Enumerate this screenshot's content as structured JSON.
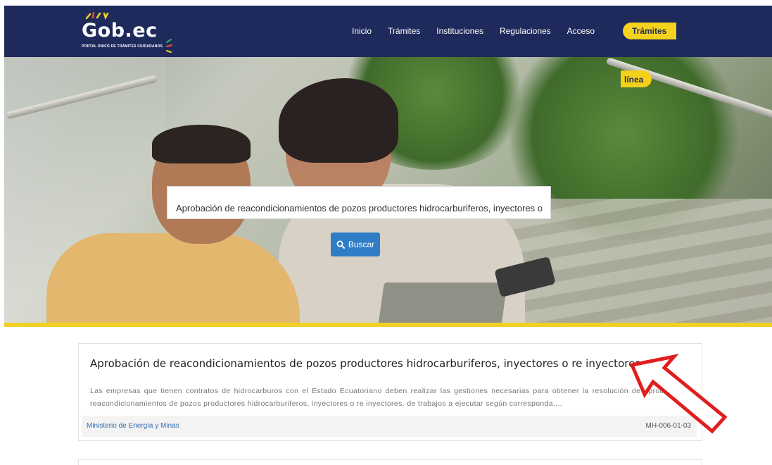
{
  "header": {
    "logo_text": "Gob.ec",
    "logo_subtitle": "PORTAL ÚNICO DE TRÁMITES CIUDADANOS",
    "nav": [
      {
        "label": "Inicio"
      },
      {
        "label": "Trámites"
      },
      {
        "label": "Instituciones"
      },
      {
        "label": "Regulaciones"
      },
      {
        "label": "Acceso"
      }
    ],
    "cta_line1": "Trámites en",
    "cta_line2": "línea",
    "colors": {
      "navbar": "#1f2a5c",
      "accent": "#f5d21d"
    }
  },
  "search": {
    "query": "Aprobación de reacondicionamientos de pozos productores hidrocarburiferos, inyectores o re inyectores",
    "button_label": "Buscar",
    "button_icon": "search-icon",
    "button_color": "#2f7cc7"
  },
  "results": [
    {
      "title": "Aprobación de reacondicionamientos de pozos productores hidrocarburiferos, inyectores o re inyectores",
      "description": "Las empresas que tienen contratos de hidrocarburos con el Estado Ecuatoriano deben realizar las gestiones necesarias para obtener la resolución de aprobación de reacondicionamientos de pozos productores hidrocarburiferos, inyectores o re inyectores, de trabajos a ejecutar según corresponda....",
      "institution": "Ministerio de Energía y Minas",
      "code": "MH-006-01-03"
    }
  ],
  "annotation": {
    "icon": "red-arrow-icon",
    "color": "#e01e1e"
  }
}
